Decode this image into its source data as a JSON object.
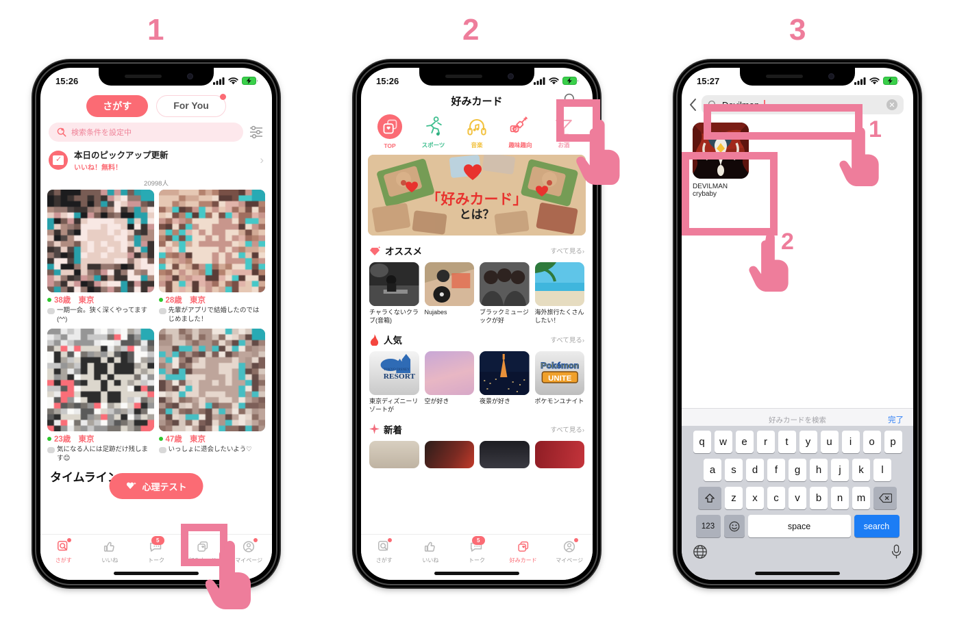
{
  "steps": [
    {
      "label": "1"
    },
    {
      "label": "2"
    },
    {
      "label": "3"
    }
  ],
  "colors": {
    "accent_pink": "#fb6b74",
    "annotation_pink": "#ee7d9b",
    "keyboard_blue": "#1c7df5",
    "link_blue": "#2d7df6"
  },
  "phone1": {
    "status": {
      "time": "15:26",
      "signal": "signal-bars",
      "wifi": "wifi",
      "battery": "battery-charging"
    },
    "tabs": [
      {
        "label": "さがす",
        "active": true
      },
      {
        "label": "For You",
        "active": false,
        "dot": true
      }
    ],
    "search_bar": {
      "text": "検索条件を設定中",
      "icon": "search-heart-icon"
    },
    "filter_icon": "filter-sliders-icon",
    "pickup": {
      "title": "本日のピックアップ更新",
      "subtitle": "いいね！無料！",
      "icon": "calendar-check-icon",
      "chevron": "›"
    },
    "result_count": "20998人",
    "cards": [
      {
        "age": "38歳",
        "area": "東京",
        "bio": "一期一会。狭く深くやってます(^^)"
      },
      {
        "age": "28歳",
        "area": "東京",
        "bio": "先輩がアプリで結婚したのではじめました！"
      },
      {
        "age": "23歳",
        "area": "東京",
        "bio": "気になる人には足跡だけ残します😊"
      },
      {
        "age": "47歳",
        "area": "東京",
        "bio": "いっしょに退会したいよう♡"
      }
    ],
    "floating_button": {
      "label": "心理テスト",
      "icon": "sparkle-heart-icon"
    },
    "timeline_title": "タイムライン",
    "tabbar": [
      {
        "label": "さがす",
        "icon": "search-square-icon",
        "active": false,
        "dot": true
      },
      {
        "label": "いいね",
        "icon": "thumbs-up-icon",
        "active": false
      },
      {
        "label": "トーク",
        "icon": "chat-icon",
        "active": false,
        "badge": "5"
      },
      {
        "label": "好みカード",
        "icon": "cards-heart-icon",
        "active": false
      },
      {
        "label": "マイページ",
        "icon": "person-circle-icon",
        "active": false,
        "dot": true
      }
    ]
  },
  "phone2": {
    "status": {
      "time": "15:26"
    },
    "title": "好みカード",
    "search_icon": "search-icon",
    "categories": [
      {
        "label": "TOP",
        "icon": "cards-heart-icon",
        "color": "#fb6b74",
        "active": true
      },
      {
        "label": "スポーツ",
        "icon": "runner-icon",
        "color": "#3fbf8f"
      },
      {
        "label": "音楽",
        "icon": "headphones-music-icon",
        "color": "#f2c13d"
      },
      {
        "label": "趣味趣向",
        "icon": "guitar-camera-icon",
        "color": "#fb6b74"
      },
      {
        "label": "お酒",
        "icon": "cocktail-icon",
        "color": "#f4a0b2"
      }
    ],
    "banner": {
      "title": "「好みカード」",
      "subtitle": "とは？"
    },
    "sections": [
      {
        "title": "オススメ",
        "icon": "gem-icon",
        "see_all": "すべて見る",
        "items": [
          {
            "label": "チャラくないクラブ(音箱)",
            "thumb": "dj-photo"
          },
          {
            "label": "Nujabes",
            "thumb": "turntable-photo"
          },
          {
            "label": "ブラックミュージックが好",
            "thumb": "trio-photo"
          },
          {
            "label": "海外旅行たくさんしたい！",
            "thumb": "beach-photo"
          }
        ]
      },
      {
        "title": "人気",
        "icon": "fire-icon",
        "see_all": "すべて見る",
        "items": [
          {
            "label": "東京ディズニーリゾートが",
            "thumb": "disney-resort-logo"
          },
          {
            "label": "空が好き",
            "thumb": "pink-sky-photo"
          },
          {
            "label": "夜景が好き",
            "thumb": "tokyo-night-photo"
          },
          {
            "label": "ポケモンユナイト",
            "thumb": "pokemon-unite-logo"
          }
        ]
      },
      {
        "title": "新着",
        "icon": "sparkle-icon",
        "see_all": "すべて見る",
        "items": [
          {
            "label": "",
            "thumb": "beige-photo"
          },
          {
            "label": "",
            "thumb": "stage-photo"
          },
          {
            "label": "",
            "thumb": "singer-photo"
          },
          {
            "label": "",
            "thumb": "curtain-photo"
          }
        ]
      }
    ],
    "tabbar": [
      {
        "label": "さがす",
        "icon": "search-square-icon",
        "dot": true
      },
      {
        "label": "いいね",
        "icon": "thumbs-up-icon"
      },
      {
        "label": "トーク",
        "icon": "chat-icon",
        "badge": "5"
      },
      {
        "label": "好みカード",
        "icon": "cards-heart-icon",
        "active": true
      },
      {
        "label": "マイページ",
        "icon": "person-circle-icon",
        "dot": true
      }
    ]
  },
  "phone3": {
    "status": {
      "time": "15:27"
    },
    "back_icon": "chevron-left-icon",
    "search": {
      "value": "Devilman",
      "icon": "search-icon",
      "clear_icon": "clear-circle-icon"
    },
    "result": {
      "line1": "DEVILMAN",
      "line2": "crybaby",
      "thumb": "devilman-crybaby-artwork"
    },
    "keyboard": {
      "accessory": {
        "placeholder": "好みカードを検索",
        "done_label": "完了"
      },
      "row1": [
        "q",
        "w",
        "e",
        "r",
        "t",
        "y",
        "u",
        "i",
        "o",
        "p"
      ],
      "row2": [
        "a",
        "s",
        "d",
        "f",
        "g",
        "h",
        "j",
        "k",
        "l"
      ],
      "row3": [
        "z",
        "x",
        "c",
        "v",
        "b",
        "n",
        "m"
      ],
      "shift_icon": "shift-icon",
      "backspace_icon": "backspace-icon",
      "numbers_label": "123",
      "emoji_icon": "emoji-icon",
      "space_label": "space",
      "return_label": "search",
      "globe_icon": "globe-icon",
      "mic_icon": "microphone-icon"
    },
    "annotations": [
      {
        "label": "1",
        "target": "search-field"
      },
      {
        "label": "2",
        "target": "result-card"
      }
    ]
  }
}
